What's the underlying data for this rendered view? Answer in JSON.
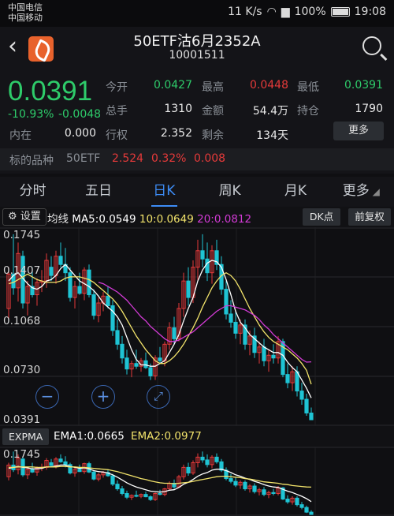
{
  "status": {
    "carrier1": "中国电信",
    "carrier2": "中国移动",
    "net_speed": "11 K/s",
    "battery": "100%",
    "time": "19:08"
  },
  "header": {
    "title": "50ETF沽6月2352A",
    "code": "10001511"
  },
  "quote": {
    "price": "0.0391",
    "pct": "-10.93%",
    "change": "-0.0048",
    "inner_label": "内在",
    "inner_value": "0.000",
    "fields": [
      {
        "label": "今开",
        "value": "0.0427"
      },
      {
        "label": "最高",
        "value": "0.0448"
      },
      {
        "label": "最低",
        "value": "0.0391"
      },
      {
        "label": "总手",
        "value": "1310"
      },
      {
        "label": "金额",
        "value": "54.4万"
      },
      {
        "label": "持仓",
        "value": "1790"
      },
      {
        "label": "行权",
        "value": "2.352"
      },
      {
        "label": "剩余",
        "value": "134天"
      }
    ],
    "more_label": "更多",
    "underlying": {
      "label": "标的品种",
      "name": "50ETF",
      "price": "2.524",
      "pct": "0.32%",
      "change": "0.008"
    }
  },
  "tabs": [
    "分时",
    "五日",
    "日K",
    "周K",
    "月K",
    "更多"
  ],
  "active_tab": "日K",
  "indicator": {
    "settings_label": "设置",
    "ma_label": "均线",
    "ma5": "MA5:0.0549",
    "ma10": "10:0.0649",
    "ma20": "20:0.0812",
    "dk_label": "DK点",
    "fq_label": "前复权"
  },
  "price_axis": [
    "0.1745",
    "0.1407",
    "0.1068",
    "0.0730",
    "0.0391"
  ],
  "ema": {
    "label": "EXPMA",
    "ema1": "EMA1:0.0665",
    "ema2": "EMA2:0.0977",
    "axis_top": "0.1745"
  },
  "colors": {
    "up": "#e63a3a",
    "down": "#1fc4d4",
    "ma5": "#ffffff",
    "ma10": "#f2e36b",
    "ma20": "#d33bd6",
    "accent": "#3d8cf5"
  },
  "chart_data": {
    "type": "candlestick",
    "y_range": [
      0.0391,
      0.1745
    ],
    "candles": [
      [
        0.12,
        0.15,
        0.112,
        0.145
      ],
      [
        0.145,
        0.174,
        0.13,
        0.135
      ],
      [
        0.135,
        0.168,
        0.125,
        0.16
      ],
      [
        0.158,
        0.162,
        0.12,
        0.124
      ],
      [
        0.124,
        0.14,
        0.115,
        0.136
      ],
      [
        0.136,
        0.15,
        0.128,
        0.13
      ],
      [
        0.13,
        0.142,
        0.122,
        0.139
      ],
      [
        0.139,
        0.148,
        0.132,
        0.14
      ],
      [
        0.14,
        0.16,
        0.135,
        0.155
      ],
      [
        0.15,
        0.158,
        0.14,
        0.144
      ],
      [
        0.144,
        0.162,
        0.138,
        0.158
      ],
      [
        0.158,
        0.168,
        0.15,
        0.152
      ],
      [
        0.152,
        0.164,
        0.14,
        0.146
      ],
      [
        0.146,
        0.15,
        0.125,
        0.128
      ],
      [
        0.128,
        0.14,
        0.12,
        0.136
      ],
      [
        0.136,
        0.146,
        0.13,
        0.131
      ],
      [
        0.131,
        0.15,
        0.126,
        0.148
      ],
      [
        0.148,
        0.152,
        0.128,
        0.13
      ],
      [
        0.13,
        0.134,
        0.112,
        0.115
      ],
      [
        0.115,
        0.128,
        0.11,
        0.124
      ],
      [
        0.124,
        0.132,
        0.118,
        0.129
      ],
      [
        0.129,
        0.136,
        0.12,
        0.122
      ],
      [
        0.122,
        0.126,
        0.1,
        0.104
      ],
      [
        0.104,
        0.112,
        0.09,
        0.094
      ],
      [
        0.094,
        0.1,
        0.08,
        0.084
      ],
      [
        0.084,
        0.09,
        0.072,
        0.076
      ],
      [
        0.076,
        0.082,
        0.07,
        0.08
      ],
      [
        0.08,
        0.09,
        0.076,
        0.078
      ],
      [
        0.078,
        0.084,
        0.074,
        0.082
      ],
      [
        0.082,
        0.088,
        0.076,
        0.077
      ],
      [
        0.077,
        0.08,
        0.068,
        0.071
      ],
      [
        0.071,
        0.086,
        0.068,
        0.084
      ],
      [
        0.084,
        0.092,
        0.08,
        0.082
      ],
      [
        0.082,
        0.096,
        0.078,
        0.094
      ],
      [
        0.094,
        0.11,
        0.09,
        0.106
      ],
      [
        0.106,
        0.114,
        0.094,
        0.098
      ],
      [
        0.098,
        0.124,
        0.096,
        0.12
      ],
      [
        0.12,
        0.146,
        0.114,
        0.14
      ],
      [
        0.14,
        0.15,
        0.122,
        0.128
      ],
      [
        0.128,
        0.155,
        0.124,
        0.15
      ],
      [
        0.15,
        0.17,
        0.14,
        0.162
      ],
      [
        0.162,
        0.174,
        0.15,
        0.156
      ],
      [
        0.156,
        0.168,
        0.14,
        0.146
      ],
      [
        0.146,
        0.166,
        0.138,
        0.162
      ],
      [
        0.162,
        0.17,
        0.148,
        0.152
      ],
      [
        0.152,
        0.158,
        0.13,
        0.134
      ],
      [
        0.134,
        0.14,
        0.112,
        0.116
      ],
      [
        0.116,
        0.126,
        0.106,
        0.11
      ],
      [
        0.11,
        0.118,
        0.098,
        0.102
      ],
      [
        0.102,
        0.112,
        0.094,
        0.108
      ],
      [
        0.108,
        0.112,
        0.09,
        0.094
      ],
      [
        0.094,
        0.104,
        0.086,
        0.1
      ],
      [
        0.1,
        0.106,
        0.084,
        0.088
      ],
      [
        0.088,
        0.096,
        0.08,
        0.092
      ],
      [
        0.092,
        0.098,
        0.078,
        0.082
      ],
      [
        0.082,
        0.09,
        0.074,
        0.086
      ],
      [
        0.086,
        0.094,
        0.08,
        0.084
      ],
      [
        0.084,
        0.1,
        0.08,
        0.096
      ],
      [
        0.096,
        0.098,
        0.07,
        0.072
      ],
      [
        0.072,
        0.08,
        0.062,
        0.066
      ],
      [
        0.066,
        0.078,
        0.06,
        0.074
      ],
      [
        0.074,
        0.078,
        0.056,
        0.06
      ],
      [
        0.06,
        0.066,
        0.05,
        0.054
      ],
      [
        0.054,
        0.058,
        0.042,
        0.044
      ],
      [
        0.044,
        0.048,
        0.039,
        0.0391
      ]
    ],
    "ma5": [
      0.14,
      0.144,
      0.146,
      0.142,
      0.138,
      0.135,
      0.134,
      0.136,
      0.14,
      0.141,
      0.144,
      0.149,
      0.152,
      0.148,
      0.144,
      0.14,
      0.138,
      0.136,
      0.133,
      0.129,
      0.124,
      0.121,
      0.118,
      0.114,
      0.108,
      0.099,
      0.09,
      0.083,
      0.079,
      0.079,
      0.078,
      0.078,
      0.08,
      0.082,
      0.088,
      0.094,
      0.101,
      0.111,
      0.12,
      0.128,
      0.14,
      0.148,
      0.153,
      0.155,
      0.154,
      0.15,
      0.141,
      0.13,
      0.118,
      0.11,
      0.106,
      0.101,
      0.098,
      0.095,
      0.092,
      0.09,
      0.088,
      0.088,
      0.086,
      0.081,
      0.077,
      0.074,
      0.068,
      0.062,
      0.055
    ],
    "ma10": [
      0.138,
      0.139,
      0.141,
      0.143,
      0.145,
      0.143,
      0.141,
      0.14,
      0.139,
      0.139,
      0.139,
      0.14,
      0.142,
      0.143,
      0.143,
      0.143,
      0.142,
      0.141,
      0.139,
      0.136,
      0.133,
      0.13,
      0.127,
      0.123,
      0.118,
      0.112,
      0.106,
      0.1,
      0.095,
      0.09,
      0.086,
      0.082,
      0.08,
      0.08,
      0.082,
      0.085,
      0.089,
      0.094,
      0.1,
      0.106,
      0.113,
      0.121,
      0.128,
      0.135,
      0.14,
      0.144,
      0.146,
      0.144,
      0.14,
      0.134,
      0.127,
      0.12,
      0.114,
      0.108,
      0.103,
      0.099,
      0.096,
      0.094,
      0.092,
      0.09,
      0.087,
      0.084,
      0.08,
      0.075,
      0.0649
    ],
    "ma20": [
      null,
      null,
      null,
      null,
      null,
      null,
      null,
      null,
      null,
      null,
      null,
      null,
      null,
      null,
      null,
      null,
      null,
      null,
      null,
      0.139,
      0.138,
      0.136,
      0.134,
      0.132,
      0.129,
      0.126,
      0.122,
      0.118,
      0.114,
      0.111,
      0.107,
      0.104,
      0.101,
      0.098,
      0.096,
      0.096,
      0.097,
      0.099,
      0.101,
      0.103,
      0.106,
      0.109,
      0.112,
      0.115,
      0.118,
      0.12,
      0.122,
      0.122,
      0.121,
      0.12,
      0.119,
      0.117,
      0.115,
      0.112,
      0.108,
      0.105,
      0.101,
      0.098,
      0.095,
      0.092,
      0.089,
      0.086,
      0.083,
      0.081,
      0.0812
    ],
    "ema1": [
      0.138,
      0.14,
      0.142,
      0.14,
      0.139,
      0.137,
      0.137,
      0.138,
      0.141,
      0.141,
      0.143,
      0.145,
      0.145,
      0.142,
      0.14,
      0.138,
      0.139,
      0.137,
      0.133,
      0.131,
      0.13,
      0.128,
      0.124,
      0.119,
      0.113,
      0.107,
      0.102,
      0.098,
      0.095,
      0.092,
      0.089,
      0.088,
      0.087,
      0.088,
      0.091,
      0.092,
      0.097,
      0.104,
      0.108,
      0.114,
      0.121,
      0.126,
      0.129,
      0.134,
      0.136,
      0.136,
      0.133,
      0.129,
      0.124,
      0.121,
      0.117,
      0.114,
      0.11,
      0.107,
      0.103,
      0.1,
      0.098,
      0.097,
      0.093,
      0.089,
      0.086,
      0.082,
      0.078,
      0.073,
      0.0665
    ],
    "ema2": [
      0.14,
      0.14,
      0.141,
      0.141,
      0.141,
      0.141,
      0.14,
      0.14,
      0.141,
      0.141,
      0.141,
      0.142,
      0.142,
      0.141,
      0.141,
      0.14,
      0.14,
      0.139,
      0.138,
      0.137,
      0.136,
      0.135,
      0.133,
      0.131,
      0.128,
      0.125,
      0.122,
      0.119,
      0.116,
      0.114,
      0.111,
      0.109,
      0.107,
      0.106,
      0.106,
      0.105,
      0.106,
      0.107,
      0.108,
      0.11,
      0.112,
      0.114,
      0.116,
      0.118,
      0.12,
      0.121,
      0.121,
      0.12,
      0.119,
      0.118,
      0.116,
      0.115,
      0.113,
      0.111,
      0.109,
      0.108,
      0.107,
      0.106,
      0.104,
      0.103,
      0.101,
      0.1,
      0.099,
      0.098,
      0.0977
    ]
  }
}
